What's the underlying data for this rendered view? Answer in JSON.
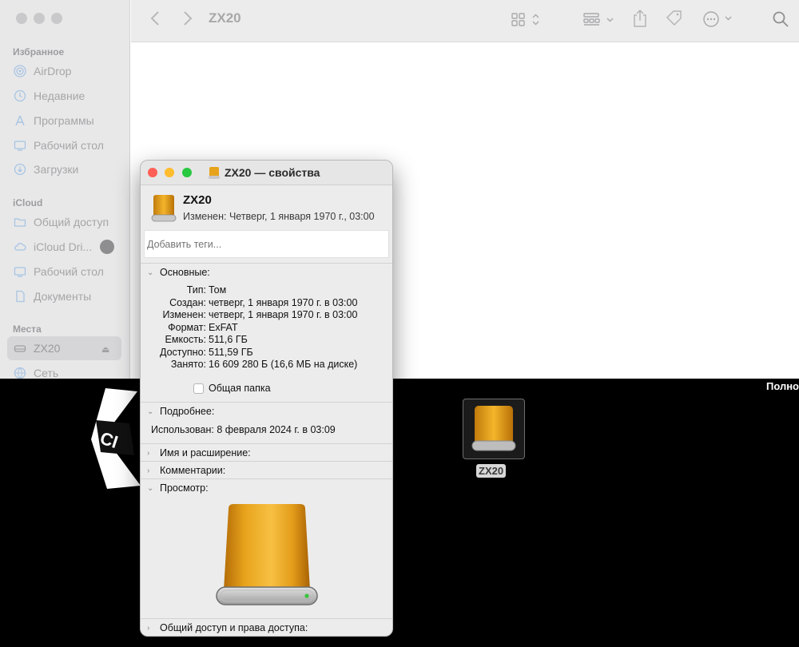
{
  "finder": {
    "title": "ZX20",
    "sidebar": {
      "favorites_heading": "Избранное",
      "icloud_heading": "iCloud",
      "places_heading": "Места",
      "favorites": [
        {
          "label": "AirDrop",
          "icon": "airdrop-icon"
        },
        {
          "label": "Недавние",
          "icon": "clock-icon"
        },
        {
          "label": "Программы",
          "icon": "applications-icon"
        },
        {
          "label": "Рабочий стол",
          "icon": "desktop-icon"
        },
        {
          "label": "Загрузки",
          "icon": "download-icon"
        }
      ],
      "icloud": [
        {
          "label": "Общий доступ",
          "icon": "shared-folder-icon"
        },
        {
          "label": "iCloud Dri...",
          "icon": "icloud-icon"
        },
        {
          "label": "Рабочий стол",
          "icon": "desktop-icon"
        },
        {
          "label": "Документы",
          "icon": "document-icon"
        }
      ],
      "places": [
        {
          "label": "ZX20",
          "icon": "drive-icon",
          "selected": true
        },
        {
          "label": "Сеть",
          "icon": "network-icon"
        }
      ]
    }
  },
  "info": {
    "title": "ZX20 — свойства",
    "name": "ZX20",
    "modified": "Изменен: Четверг, 1 января 1970 г., 03:00",
    "tags_placeholder": "Добавить теги...",
    "general_heading": "Основные:",
    "general": [
      {
        "key": "Тип:",
        "value": "Том"
      },
      {
        "key": "Создан:",
        "value": "четверг, 1 января 1970 г. в 03:00"
      },
      {
        "key": "Изменен:",
        "value": "четверг, 1 января 1970 г. в 03:00"
      },
      {
        "key": "Формат:",
        "value": "ExFAT"
      },
      {
        "key": "Емкость:",
        "value": "511,6 ГБ"
      },
      {
        "key": "Доступно:",
        "value": "511,59 ГБ"
      },
      {
        "key": "Занято:",
        "value": "16 609 280 Б (16,6 МБ на диске)"
      }
    ],
    "shared_folder_label": "Общая папка",
    "more_heading": "Подробнее:",
    "last_used": "Использован: 8 февраля 2024 г. в 03:09",
    "name_ext_heading": "Имя и расширение:",
    "comments_heading": "Комментарии:",
    "preview_heading": "Просмотр:",
    "sharing_heading": "Общий доступ и права доступа:"
  },
  "desktop": {
    "icon_label": "ZX20",
    "top_right_text": "Полно"
  },
  "colors": {
    "drive_gold": "#e8a31c",
    "close": "#ff5f57",
    "minimize": "#febc2e",
    "zoom": "#28c840"
  }
}
